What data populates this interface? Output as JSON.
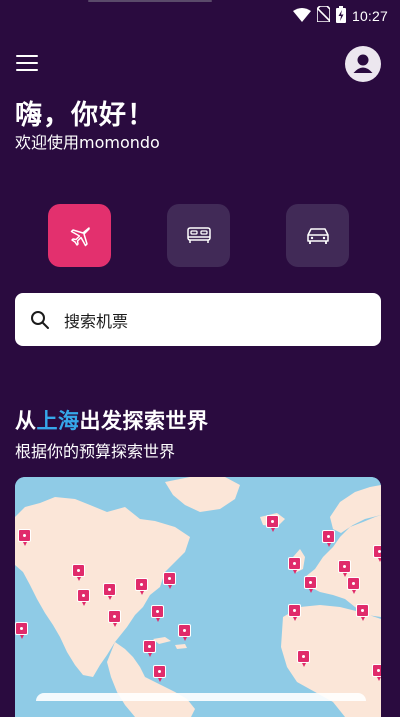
{
  "status": {
    "time": "10:27",
    "icons": [
      "wifi-icon",
      "no-sim-icon",
      "battery-charging-icon"
    ]
  },
  "header": {
    "menu_icon": "menu-icon",
    "avatar_icon": "user-icon"
  },
  "greeting": {
    "title": "嗨，你好！",
    "subtitle": "欢迎使用momondo"
  },
  "verticals": [
    {
      "name": "flights",
      "icon": "airplane-icon",
      "active": true
    },
    {
      "name": "hotels",
      "icon": "bed-icon",
      "active": false
    },
    {
      "name": "cars",
      "icon": "car-icon",
      "active": false
    }
  ],
  "search": {
    "label": "搜索机票",
    "icon": "search-icon"
  },
  "explore": {
    "title_prefix": "从",
    "city": "上海",
    "title_suffix": "出发探索世界",
    "subtitle": "根据你的预算探索世界"
  },
  "colors": {
    "background": "#2a0b3f",
    "accent": "#e3306e",
    "tile": "#412a57",
    "city_highlight": "#36a7ea",
    "map_water": "#8fcbe6",
    "map_land": "#fbe6d8",
    "pin": "#e02b6b"
  }
}
